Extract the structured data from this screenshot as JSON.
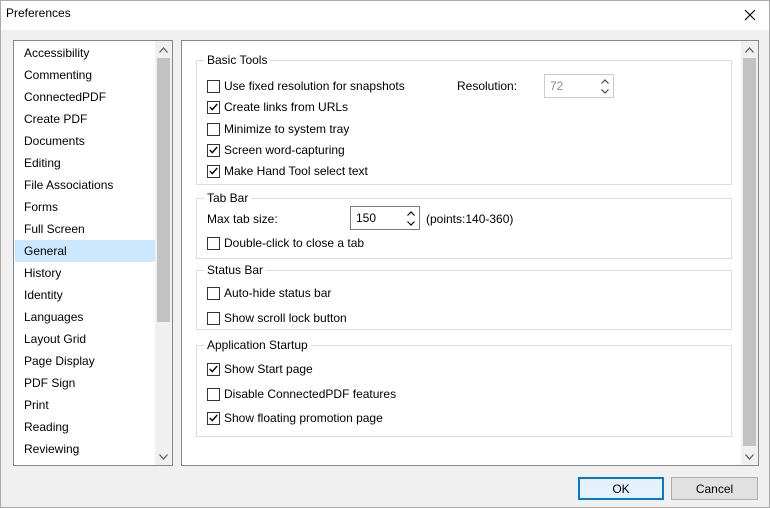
{
  "window": {
    "title": "Preferences"
  },
  "categories": {
    "selected": "General",
    "items": [
      "Accessibility",
      "Commenting",
      "ConnectedPDF",
      "Create PDF",
      "Documents",
      "Editing",
      "File Associations",
      "Forms",
      "Full Screen",
      "General",
      "History",
      "Identity",
      "Languages",
      "Layout Grid",
      "Page Display",
      "PDF Sign",
      "Print",
      "Reading",
      "Reviewing"
    ]
  },
  "basic_tools": {
    "title": "Basic Tools",
    "fixed_resolution": {
      "label": "Use fixed resolution for snapshots",
      "checked": false
    },
    "resolution_label": "Resolution:",
    "resolution_value": "72",
    "create_links": {
      "label": "Create links from URLs",
      "checked": true
    },
    "minimize_tray": {
      "label": "Minimize to system tray",
      "checked": false
    },
    "word_capturing": {
      "label": "Screen word-capturing",
      "checked": true
    },
    "hand_tool": {
      "label": "Make Hand Tool select text",
      "checked": true
    }
  },
  "tab_bar": {
    "title": "Tab Bar",
    "max_size_label": "Max tab size:",
    "max_size_value": "150",
    "range_hint": "(points:140-360)",
    "double_click_close": {
      "label": "Double-click to close a tab",
      "checked": false
    }
  },
  "status_bar": {
    "title": "Status Bar",
    "auto_hide": {
      "label": "Auto-hide status bar",
      "checked": false
    },
    "scroll_lock": {
      "label": "Show scroll lock button",
      "checked": false
    }
  },
  "startup": {
    "title": "Application Startup",
    "start_page": {
      "label": "Show Start page",
      "checked": true
    },
    "disable_cpdf": {
      "label": "Disable ConnectedPDF features",
      "checked": false
    },
    "promotion_page": {
      "label": "Show floating promotion page",
      "checked": true
    }
  },
  "buttons": {
    "ok": "OK",
    "cancel": "Cancel"
  },
  "colors": {
    "accent": "#0078d7",
    "selection": "#cce8ff"
  }
}
